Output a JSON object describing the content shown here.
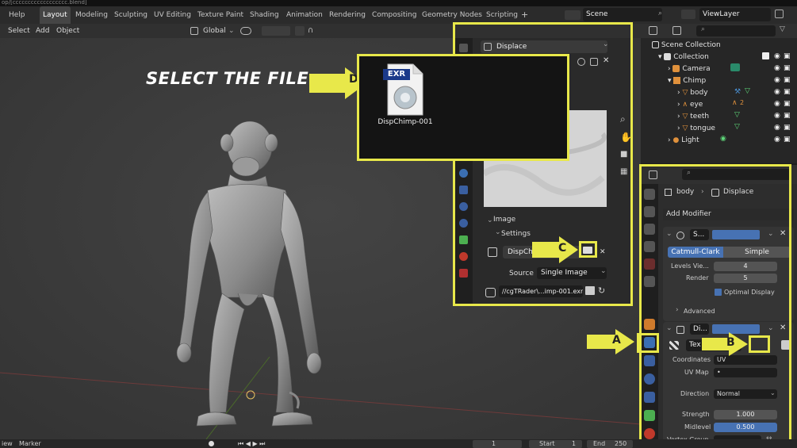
{
  "title_bar": "op/[cccccccccccccccccc.blend]",
  "menu": {
    "help": "Help"
  },
  "workspaces": [
    "Layout",
    "Modeling",
    "Sculpting",
    "UV Editing",
    "Texture Paint",
    "Shading",
    "Animation",
    "Rendering",
    "Compositing",
    "Geometry Nodes",
    "Scripting"
  ],
  "add_workspace": "+",
  "scene": {
    "name": "Scene",
    "view_layer": "ViewLayer"
  },
  "viewport_header": {
    "select": "Select",
    "add": "Add",
    "object": "Object",
    "orientation": "Global"
  },
  "annotation": {
    "text": "SELECT THE FILE",
    "a": "A",
    "b": "B",
    "c": "C",
    "d": "D"
  },
  "file_browser": {
    "badge": "EXR",
    "filename": "DispChimp-001"
  },
  "zoom_panel": {
    "modifier_name": "Displace",
    "image_section": "Image",
    "settings_section": "Settings",
    "image_name": "DispChim",
    "source_label": "Source",
    "source_value": "Single Image",
    "filepath": "//cgTRader\\...imp-001.exr"
  },
  "outliner": {
    "scene_collection": "Scene Collection",
    "items": [
      {
        "label": "Collection"
      },
      {
        "label": "Camera"
      },
      {
        "label": "Chimp"
      },
      {
        "label": "body"
      },
      {
        "label": "eye"
      },
      {
        "label": "teeth"
      },
      {
        "label": "tongue"
      },
      {
        "label": "Light"
      }
    ],
    "eye_badge": "2"
  },
  "properties": {
    "breadcrumb_object": "body",
    "breadcrumb_modifier": "Displace",
    "add_modifier": "Add Modifier",
    "subsurf": {
      "name": "S...",
      "catmull": "Catmull-Clark",
      "simple": "Simple",
      "levels_label": "Levels Vie...",
      "levels_value": "4",
      "render_label": "Render",
      "render_value": "5",
      "optimal": "Optimal Display",
      "advanced": "Advanced"
    },
    "displace": {
      "name": "Di...",
      "texture": "Tex",
      "coordinates_label": "Coordinates",
      "coordinates_value": "UV",
      "uvmap_label": "UV Map",
      "uvmap_value": "•",
      "direction_label": "Direction",
      "direction_value": "Normal",
      "strength_label": "Strength",
      "strength_value": "1.000",
      "midlevel_label": "Midlevel",
      "midlevel_value": "0.500",
      "vgroup_label": "Vertex Group"
    }
  },
  "timeline": {
    "view": "iew",
    "marker": "Marker",
    "current_frame": "1",
    "start_label": "Start",
    "start_value": "1",
    "end_label": "End",
    "end_value": "250"
  },
  "colors": {
    "highlight": "#e8e84a",
    "accent_blue": "#4772b3",
    "mesh_orange": "#e08f3c",
    "vgroup_green": "#5fd87a"
  }
}
